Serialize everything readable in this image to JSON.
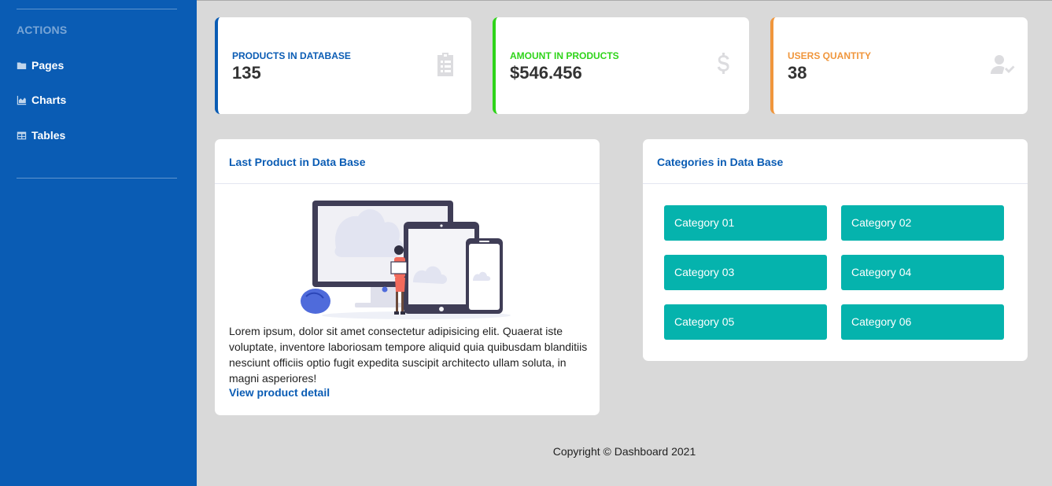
{
  "sidebar": {
    "heading": "ACTIONS",
    "items": [
      {
        "label": "Pages",
        "icon": "folder-icon"
      },
      {
        "label": "Charts",
        "icon": "area-chart-icon"
      },
      {
        "label": "Tables",
        "icon": "table-icon"
      }
    ]
  },
  "stats": [
    {
      "label": "PRODUCTS IN DATABASE",
      "value": "135",
      "color": "#0a5cb4",
      "icon": "clipboard-list-icon"
    },
    {
      "label": "AMOUNT IN PRODUCTS",
      "value": "$546.456",
      "color": "#2fd41a",
      "icon": "dollar-icon"
    },
    {
      "label": "USERS QUANTITY",
      "value": "38",
      "color": "#f0963c",
      "icon": "user-check-icon"
    }
  ],
  "last_product": {
    "title": "Last Product in Data Base",
    "description": "Lorem ipsum, dolor sit amet consectetur adipisicing elit. Quaerat iste voluptate, inventore laboriosam tempore aliquid quia quibusdam blanditiis nesciunt officiis optio fugit expedita suscipit architecto ullam soluta, in magni asperiores!",
    "link": "View product detail"
  },
  "categories": {
    "title": "Categories in Data Base",
    "items": [
      "Category 01",
      "Category 02",
      "Category 03",
      "Category 04",
      "Category 05",
      "Category 06"
    ]
  },
  "footer": "Copyright © Dashboard 2021",
  "colors": {
    "sidebar": "#0a5cb4",
    "category": "#05b3ad",
    "background": "#d9d9d9"
  }
}
